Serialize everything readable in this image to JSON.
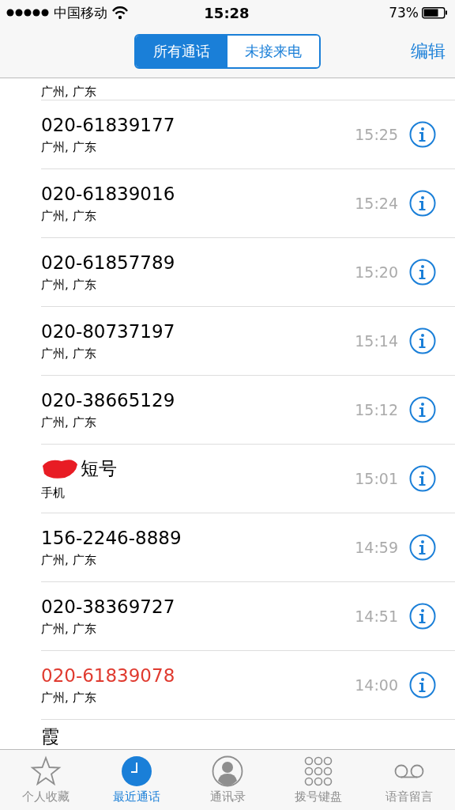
{
  "status_bar": {
    "carrier": "中国移动",
    "time": "15:28",
    "battery": "73%"
  },
  "segments": [
    {
      "label": "所有通话",
      "selected": true
    },
    {
      "label": "未接来电",
      "selected": false
    }
  ],
  "edit_button": "编辑",
  "partial_top_row": {
    "subtitle": "广州, 广东"
  },
  "calls": [
    {
      "name": "020-61839177",
      "subtitle": "广州, 广东",
      "time": "15:25",
      "missed": false,
      "redacted": false
    },
    {
      "name": "020-61839016",
      "subtitle": "广州, 广东",
      "time": "15:24",
      "missed": false,
      "redacted": false
    },
    {
      "name": "020-61857789",
      "subtitle": "广州, 广东",
      "time": "15:20",
      "missed": false,
      "redacted": false
    },
    {
      "name": "020-80737197",
      "subtitle": "广州, 广东",
      "time": "15:14",
      "missed": false,
      "redacted": false
    },
    {
      "name": "020-38665129",
      "subtitle": "广州, 广东",
      "time": "15:12",
      "missed": false,
      "redacted": false
    },
    {
      "name": "短号",
      "subtitle": "手机",
      "time": "15:01",
      "missed": false,
      "redacted": true
    },
    {
      "name": "156-2246-8889",
      "subtitle": "广州, 广东",
      "time": "14:59",
      "missed": false,
      "redacted": false
    },
    {
      "name": "020-38369727",
      "subtitle": "广州, 广东",
      "time": "14:51",
      "missed": false,
      "redacted": false
    },
    {
      "name": "020-61839078",
      "subtitle": "广州, 广东",
      "time": "14:00",
      "missed": true,
      "redacted": false
    }
  ],
  "partial_bottom_row": {
    "name": "霞"
  },
  "tab_bar": [
    {
      "kind": "star",
      "label": "个人收藏",
      "selected": false
    },
    {
      "kind": "clock",
      "label": "最近通话",
      "selected": true
    },
    {
      "kind": "person",
      "label": "通讯录",
      "selected": false
    },
    {
      "kind": "keypad",
      "label": "拨号键盘",
      "selected": false
    },
    {
      "kind": "voicemail",
      "label": "语音留言",
      "selected": false
    }
  ]
}
